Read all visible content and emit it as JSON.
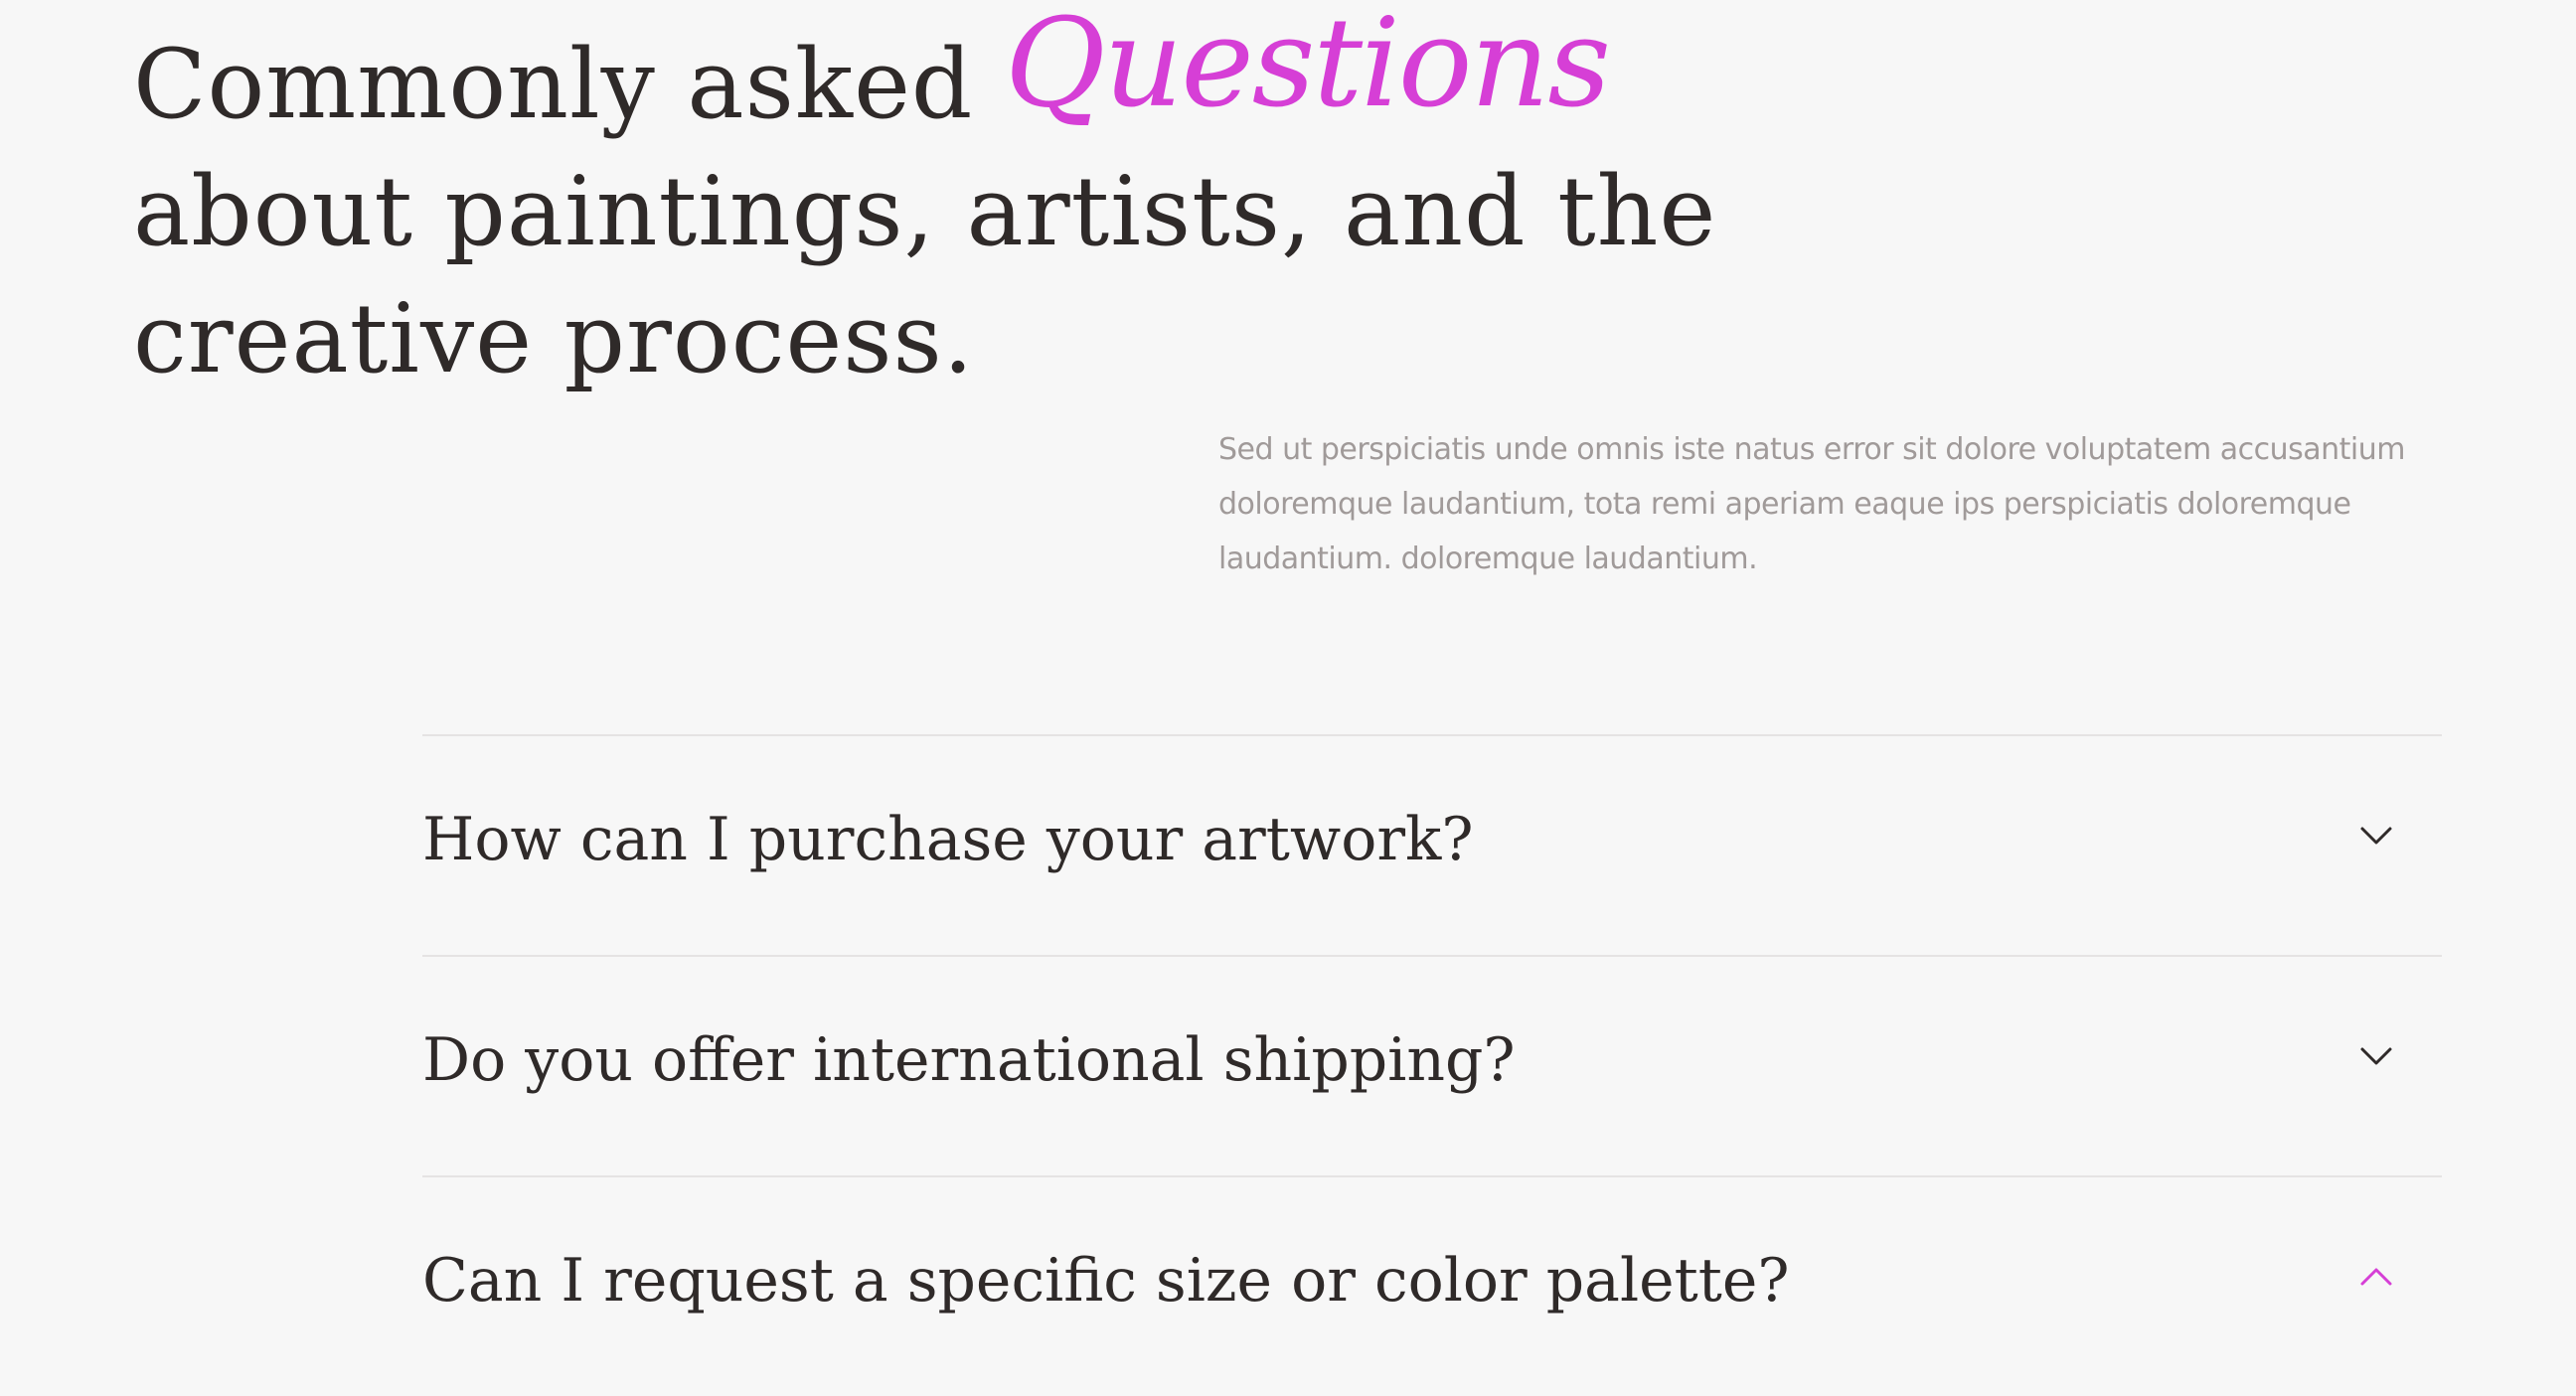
{
  "hero": {
    "heading_line1_prefix": "Commonly asked ",
    "heading_accent": "Questions",
    "heading_line2": "about paintings, artists, and the",
    "heading_line3": "creative process.",
    "intro": "Sed ut perspiciatis unde omnis iste natus error sit dolore voluptatem accusantium doloremque laudantium, tota remi aperiam eaque ips perspiciatis doloremque laudantium. doloremque laudantium."
  },
  "faq": {
    "items": [
      {
        "question": "How can I purchase your artwork?",
        "expanded": false,
        "icon": "chevron-down-icon"
      },
      {
        "question": "Do you offer international shipping?",
        "expanded": false,
        "icon": "chevron-down-icon"
      },
      {
        "question": "Can I request a specific size or color palette?",
        "expanded": true,
        "icon": "chevron-up-icon"
      }
    ]
  },
  "colors": {
    "accent": "#d63fd6",
    "text": "#2f2a29",
    "muted": "#a09a99",
    "divider": "#e5e3e3",
    "background": "#f7f7f7"
  }
}
